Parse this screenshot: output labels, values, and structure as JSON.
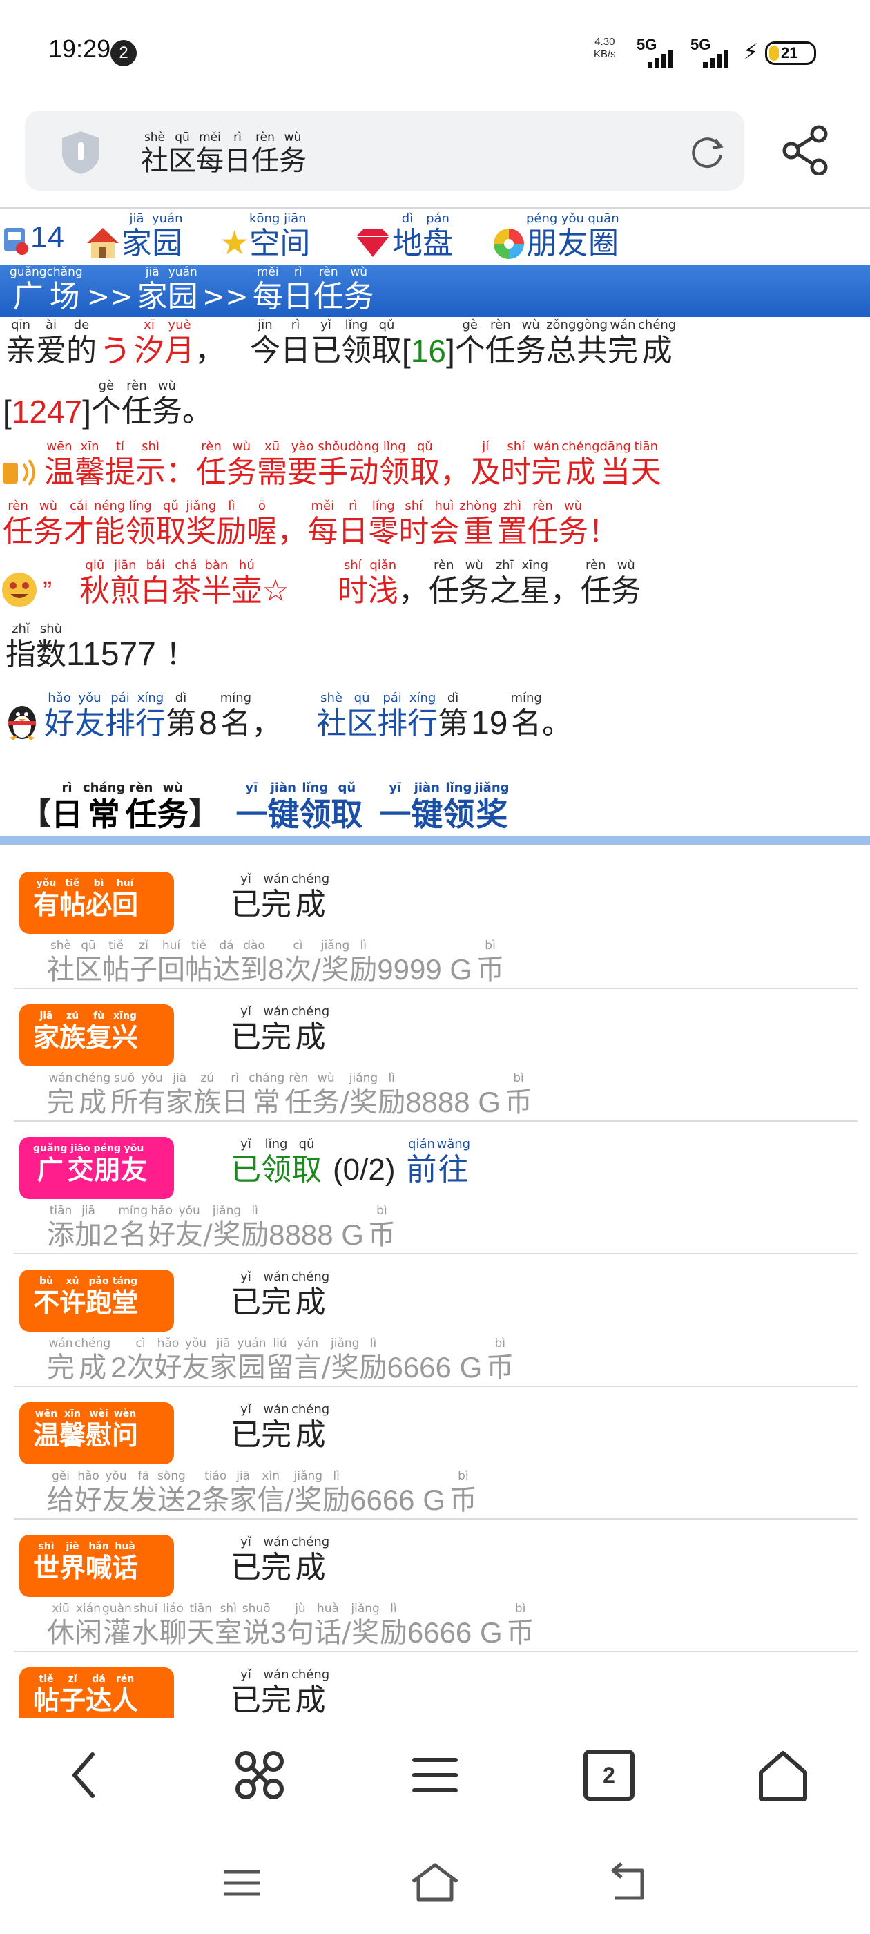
{
  "status_bar": {
    "time": "19:29",
    "notification_count": "2",
    "net_speed_value": "4.30",
    "net_speed_unit": "KB/s",
    "signal1": "5G",
    "signal2": "5G",
    "battery": "21"
  },
  "address_bar": {
    "title_chars": [
      {
        "hz": "社",
        "py": "shè"
      },
      {
        "hz": "区",
        "py": "qū"
      },
      {
        "hz": "每",
        "py": "měi"
      },
      {
        "hz": "日",
        "py": "rì"
      },
      {
        "hz": "任",
        "py": "rèn"
      },
      {
        "hz": "务",
        "py": "wù"
      }
    ]
  },
  "top_nav": {
    "mail_count": "14",
    "items": [
      {
        "icon": "house-icon",
        "chars": [
          {
            "hz": "家",
            "py": "jiā"
          },
          {
            "hz": "园",
            "py": "yuán"
          }
        ]
      },
      {
        "icon": "star-icon",
        "chars": [
          {
            "hz": "空",
            "py": "kōng"
          },
          {
            "hz": "间",
            "py": "jiān"
          }
        ]
      },
      {
        "icon": "gem-icon",
        "chars": [
          {
            "hz": "地",
            "py": "dì"
          },
          {
            "hz": "盘",
            "py": "pán"
          }
        ]
      },
      {
        "icon": "pinwheel-icon",
        "chars": [
          {
            "hz": "朋",
            "py": "péng"
          },
          {
            "hz": "友",
            "py": "yǒu"
          },
          {
            "hz": "圈",
            "py": "quān"
          }
        ]
      }
    ]
  },
  "breadcrumb": {
    "parts": [
      [
        {
          "hz": "广",
          "py": "guǎng"
        },
        {
          "hz": "场",
          "py": "chǎng"
        }
      ],
      [
        {
          "hz": "家",
          "py": "jiā"
        },
        {
          "hz": "园",
          "py": "yuán"
        }
      ],
      [
        {
          "hz": "每",
          "py": "měi"
        },
        {
          "hz": "日",
          "py": "rì"
        },
        {
          "hz": "任",
          "py": "rèn"
        },
        {
          "hz": "务",
          "py": "wù"
        }
      ]
    ],
    "separator": ">>"
  },
  "intro": {
    "prefix": [
      {
        "hz": "亲",
        "py": "qīn"
      },
      {
        "hz": "爱",
        "py": "ài"
      },
      {
        "hz": "的",
        "py": "de"
      }
    ],
    "username_mark": "う",
    "username": [
      {
        "hz": "汐",
        "py": "xī"
      },
      {
        "hz": "月",
        "py": "yuè"
      }
    ],
    "comma": "，",
    "today_text": [
      {
        "hz": "今",
        "py": "jīn"
      },
      {
        "hz": "日",
        "py": "rì"
      },
      {
        "hz": "已",
        "py": "yǐ"
      },
      {
        "hz": "领",
        "py": "lǐng"
      },
      {
        "hz": "取",
        "py": "qǔ"
      }
    ],
    "today_count": "16",
    "mid_text": [
      {
        "hz": "个",
        "py": "gè"
      },
      {
        "hz": "任",
        "py": "rèn"
      },
      {
        "hz": "务",
        "py": "wù"
      },
      {
        "hz": " ",
        "py": ""
      },
      {
        "hz": "总",
        "py": "zǒng"
      },
      {
        "hz": "共",
        "py": "gòng"
      },
      {
        "hz": "完",
        "py": "wán"
      },
      {
        "hz": "成",
        "py": "chéng"
      }
    ],
    "total_count": "1247",
    "end_text": [
      {
        "hz": "个",
        "py": "gè"
      },
      {
        "hz": "任",
        "py": "rèn"
      },
      {
        "hz": "务",
        "py": "wù"
      },
      {
        "hz": "。",
        "py": ""
      }
    ]
  },
  "tip": {
    "label": [
      {
        "hz": "温",
        "py": "wēn"
      },
      {
        "hz": "馨",
        "py": "xīn"
      },
      {
        "hz": "提",
        "py": "tí"
      },
      {
        "hz": "示",
        "py": "shì"
      },
      {
        "hz": "：",
        "py": ""
      }
    ],
    "line1": [
      {
        "hz": "任",
        "py": "rèn"
      },
      {
        "hz": "务",
        "py": "wù"
      },
      {
        "hz": "需",
        "py": "xū"
      },
      {
        "hz": "要",
        "py": "yào"
      },
      {
        "hz": "手",
        "py": "shǒu"
      },
      {
        "hz": "动",
        "py": "dòng"
      },
      {
        "hz": "领",
        "py": "lǐng"
      },
      {
        "hz": "取",
        "py": "qǔ"
      },
      {
        "hz": "，",
        "py": ""
      },
      {
        "hz": "及",
        "py": "jí"
      },
      {
        "hz": "时",
        "py": "shí"
      },
      {
        "hz": "完",
        "py": "wán"
      },
      {
        "hz": "成",
        "py": "chéng"
      },
      {
        "hz": "当",
        "py": "dāng"
      },
      {
        "hz": "天",
        "py": "tiān"
      }
    ],
    "line2": [
      {
        "hz": "任",
        "py": "rèn"
      },
      {
        "hz": "务",
        "py": "wù"
      },
      {
        "hz": "才",
        "py": "cái"
      },
      {
        "hz": "能",
        "py": "néng"
      },
      {
        "hz": "领",
        "py": "lǐng"
      },
      {
        "hz": "取",
        "py": "qǔ"
      },
      {
        "hz": "奖",
        "py": "jiǎng"
      },
      {
        "hz": "励",
        "py": "lì"
      },
      {
        "hz": "喔",
        "py": "ō"
      },
      {
        "hz": "，",
        "py": ""
      },
      {
        "hz": "每",
        "py": "měi"
      },
      {
        "hz": "日",
        "py": "rì"
      },
      {
        "hz": "零",
        "py": "líng"
      },
      {
        "hz": "时",
        "py": "shí"
      },
      {
        "hz": "会",
        "py": "huì"
      },
      {
        "hz": "重",
        "py": "zhòng"
      },
      {
        "hz": "置",
        "py": "zhì"
      },
      {
        "hz": "任",
        "py": "rèn"
      },
      {
        "hz": "务",
        "py": "wù"
      },
      {
        "hz": "！",
        "py": ""
      }
    ]
  },
  "star": {
    "quote_mark": "”",
    "name": [
      {
        "hz": "秋",
        "py": "qiū"
      },
      {
        "hz": "煎",
        "py": "jiān"
      },
      {
        "hz": "白",
        "py": "bái"
      },
      {
        "hz": "茶",
        "py": "chá"
      },
      {
        "hz": "半",
        "py": "bàn"
      },
      {
        "hz": "壶",
        "py": "hú"
      },
      {
        "hz": "☆",
        "py": ""
      }
    ],
    "rank_word": [
      {
        "hz": "时",
        "py": "shí"
      },
      {
        "hz": "浅",
        "py": "qiǎn"
      }
    ],
    "text": [
      {
        "hz": "，",
        "py": ""
      },
      {
        "hz": "任",
        "py": "rèn"
      },
      {
        "hz": "务",
        "py": "wù"
      },
      {
        "hz": "之",
        "py": "zhī"
      },
      {
        "hz": "星",
        "py": "xīng"
      },
      {
        "hz": "，",
        "py": ""
      },
      {
        "hz": "任",
        "py": "rèn"
      },
      {
        "hz": "务",
        "py": "wù"
      }
    ],
    "index_label": [
      {
        "hz": "指",
        "py": "zhǐ"
      },
      {
        "hz": "数",
        "py": "shù"
      }
    ],
    "index_value": "11577",
    "exclaim": "！"
  },
  "ranking": {
    "friend_label": [
      {
        "hz": "好",
        "py": "hǎo"
      },
      {
        "hz": "友",
        "py": "yǒu"
      },
      {
        "hz": "排",
        "py": "pái"
      },
      {
        "hz": "行",
        "py": "xíng"
      }
    ],
    "friend_rank": "8",
    "community_label": [
      {
        "hz": "社",
        "py": "shè"
      },
      {
        "hz": "区",
        "py": "qū"
      },
      {
        "hz": "排",
        "py": "pái"
      },
      {
        "hz": "行",
        "py": "xíng"
      }
    ],
    "community_rank": "19",
    "di": {
      "hz": "第",
      "py": "dì"
    },
    "ming": {
      "hz": "名",
      "py": "míng"
    },
    "comma": "，",
    "period": "。"
  },
  "daily": {
    "open_bracket": "【",
    "title": [
      {
        "hz": "日",
        "py": "rì"
      },
      {
        "hz": "常",
        "py": "cháng"
      },
      {
        "hz": "任",
        "py": "rèn"
      },
      {
        "hz": "务",
        "py": "wù"
      }
    ],
    "close_bracket": "】",
    "claim_all": [
      {
        "hz": "一",
        "py": "yī"
      },
      {
        "hz": "键",
        "py": "jiàn"
      },
      {
        "hz": "领",
        "py": "lǐng"
      },
      {
        "hz": "取",
        "py": "qǔ"
      }
    ],
    "claim_rewards": [
      {
        "hz": "一",
        "py": "yī"
      },
      {
        "hz": "键",
        "py": "jiàn"
      },
      {
        "hz": "领",
        "py": "lǐng"
      },
      {
        "hz": "奖",
        "py": "jiǎng"
      }
    ]
  },
  "tasks": [
    {
      "tag": [
        {
          "hz": "有",
          "py": "yǒu"
        },
        {
          "hz": "帖",
          "py": "tiě"
        },
        {
          "hz": "必",
          "py": "bì"
        },
        {
          "hz": "回",
          "py": "huí"
        }
      ],
      "tag_color": "#ff6a00",
      "status": [
        {
          "hz": "已",
          "py": "yǐ"
        },
        {
          "hz": "完",
          "py": "wán"
        },
        {
          "hz": "成",
          "py": "chéng"
        }
      ],
      "desc_a": [
        {
          "hz": "社",
          "py": "shè"
        },
        {
          "hz": "区",
          "py": "qū"
        },
        {
          "hz": "帖",
          "py": "tiě"
        },
        {
          "hz": "子",
          "py": "zǐ"
        },
        {
          "hz": "回",
          "py": "huí"
        },
        {
          "hz": "帖",
          "py": "tiě"
        },
        {
          "hz": "达",
          "py": "dá"
        },
        {
          "hz": "到",
          "py": "dào"
        }
      ],
      "desc_num": "8",
      "desc_b": [
        {
          "hz": "次",
          "py": "cì"
        },
        {
          "hz": "/",
          "py": ""
        },
        {
          "hz": "奖",
          "py": "jiǎng"
        },
        {
          "hz": "励",
          "py": "lì"
        }
      ],
      "reward": "9999 G",
      "currency": {
        "hz": "币",
        "py": "bì"
      }
    },
    {
      "tag": [
        {
          "hz": "家",
          "py": "jiā"
        },
        {
          "hz": "族",
          "py": "zú"
        },
        {
          "hz": "复",
          "py": "fù"
        },
        {
          "hz": "兴",
          "py": "xīng"
        }
      ],
      "tag_color": "#ff6a00",
      "status": [
        {
          "hz": "已",
          "py": "yǐ"
        },
        {
          "hz": "完",
          "py": "wán"
        },
        {
          "hz": "成",
          "py": "chéng"
        }
      ],
      "desc_a": [
        {
          "hz": "完",
          "py": "wán"
        },
        {
          "hz": "成",
          "py": "chéng"
        },
        {
          "hz": "所",
          "py": "suǒ"
        },
        {
          "hz": "有",
          "py": "yǒu"
        },
        {
          "hz": "家",
          "py": "jiā"
        },
        {
          "hz": "族",
          "py": "zú"
        },
        {
          "hz": "日",
          "py": "rì"
        },
        {
          "hz": "常",
          "py": "cháng"
        },
        {
          "hz": "任",
          "py": "rèn"
        },
        {
          "hz": "务",
          "py": "wù"
        }
      ],
      "desc_num": "",
      "desc_b": [
        {
          "hz": "/",
          "py": ""
        },
        {
          "hz": "奖",
          "py": "jiǎng"
        },
        {
          "hz": "励",
          "py": "lì"
        }
      ],
      "reward": "8888 G",
      "currency": {
        "hz": "币",
        "py": "bì"
      }
    },
    {
      "tag": [
        {
          "hz": "广",
          "py": "guǎng"
        },
        {
          "hz": "交",
          "py": "jiāo"
        },
        {
          "hz": "朋",
          "py": "péng"
        },
        {
          "hz": "友",
          "py": "yǒu"
        }
      ],
      "tag_color": "#ff1e8c",
      "status_green": [
        {
          "hz": "已",
          "py": "yǐ"
        },
        {
          "hz": "领",
          "py": "lǐng"
        },
        {
          "hz": "取",
          "py": "qǔ"
        }
      ],
      "progress": "(0/2)",
      "go_link": [
        {
          "hz": "前",
          "py": "qián"
        },
        {
          "hz": "往",
          "py": "wǎng"
        }
      ],
      "desc_a": [
        {
          "hz": "添",
          "py": "tiān"
        },
        {
          "hz": "加",
          "py": "jiā"
        }
      ],
      "desc_num": "2",
      "desc_b": [
        {
          "hz": "名",
          "py": "míng"
        },
        {
          "hz": "好",
          "py": "hǎo"
        },
        {
          "hz": "友",
          "py": "yǒu"
        },
        {
          "hz": "/",
          "py": ""
        },
        {
          "hz": "奖",
          "py": "jiǎng"
        },
        {
          "hz": "励",
          "py": "lì"
        }
      ],
      "reward": "8888 G",
      "currency": {
        "hz": "币",
        "py": "bì"
      }
    },
    {
      "tag": [
        {
          "hz": "不",
          "py": "bù"
        },
        {
          "hz": "许",
          "py": "xǔ"
        },
        {
          "hz": "跑",
          "py": "pǎo"
        },
        {
          "hz": "堂",
          "py": "táng"
        }
      ],
      "tag_color": "#ff6a00",
      "status": [
        {
          "hz": "已",
          "py": "yǐ"
        },
        {
          "hz": "完",
          "py": "wán"
        },
        {
          "hz": "成",
          "py": "chéng"
        }
      ],
      "desc_a": [
        {
          "hz": "完",
          "py": "wán"
        },
        {
          "hz": "成",
          "py": "chéng"
        }
      ],
      "desc_num": "2",
      "desc_b": [
        {
          "hz": "次",
          "py": "cì"
        },
        {
          "hz": "好",
          "py": "hǎo"
        },
        {
          "hz": "友",
          "py": "yǒu"
        },
        {
          "hz": "家",
          "py": "jiā"
        },
        {
          "hz": "园",
          "py": "yuán"
        },
        {
          "hz": "留",
          "py": "liú"
        },
        {
          "hz": "言",
          "py": "yán"
        },
        {
          "hz": "/",
          "py": ""
        },
        {
          "hz": "奖",
          "py": "jiǎng"
        },
        {
          "hz": "励",
          "py": "lì"
        }
      ],
      "reward": "6666 G",
      "currency": {
        "hz": "币",
        "py": "bì"
      }
    },
    {
      "tag": [
        {
          "hz": "温",
          "py": "wēn"
        },
        {
          "hz": "馨",
          "py": "xīn"
        },
        {
          "hz": "慰",
          "py": "wèi"
        },
        {
          "hz": "问",
          "py": "wèn"
        }
      ],
      "tag_color": "#ff6a00",
      "status": [
        {
          "hz": "已",
          "py": "yǐ"
        },
        {
          "hz": "完",
          "py": "wán"
        },
        {
          "hz": "成",
          "py": "chéng"
        }
      ],
      "desc_a": [
        {
          "hz": "给",
          "py": "gěi"
        },
        {
          "hz": "好",
          "py": "hǎo"
        },
        {
          "hz": "友",
          "py": "yǒu"
        },
        {
          "hz": "发",
          "py": "fā"
        },
        {
          "hz": "送",
          "py": "sòng"
        }
      ],
      "desc_num": "2",
      "desc_b": [
        {
          "hz": "条",
          "py": "tiáo"
        },
        {
          "hz": "家",
          "py": "jiā"
        },
        {
          "hz": "信",
          "py": "xìn"
        },
        {
          "hz": "/",
          "py": ""
        },
        {
          "hz": "奖",
          "py": "jiǎng"
        },
        {
          "hz": "励",
          "py": "lì"
        }
      ],
      "reward": "6666 G",
      "currency": {
        "hz": "币",
        "py": "bì"
      }
    },
    {
      "tag": [
        {
          "hz": "世",
          "py": "shì"
        },
        {
          "hz": "界",
          "py": "jiè"
        },
        {
          "hz": "喊",
          "py": "hǎn"
        },
        {
          "hz": "话",
          "py": "huà"
        }
      ],
      "tag_color": "#ff6a00",
      "status": [
        {
          "hz": "已",
          "py": "yǐ"
        },
        {
          "hz": "完",
          "py": "wán"
        },
        {
          "hz": "成",
          "py": "chéng"
        }
      ],
      "desc_a": [
        {
          "hz": "休",
          "py": "xiū"
        },
        {
          "hz": "闲",
          "py": "xián"
        },
        {
          "hz": "灌",
          "py": "guàn"
        },
        {
          "hz": "水",
          "py": "shuǐ"
        },
        {
          "hz": "聊",
          "py": "liáo"
        },
        {
          "hz": "天",
          "py": "tiān"
        },
        {
          "hz": "室",
          "py": "shì"
        },
        {
          "hz": "说",
          "py": "shuō"
        }
      ],
      "desc_num": "3",
      "desc_b": [
        {
          "hz": "句",
          "py": "jù"
        },
        {
          "hz": "话",
          "py": "huà"
        },
        {
          "hz": "/",
          "py": ""
        },
        {
          "hz": "奖",
          "py": "jiǎng"
        },
        {
          "hz": "励",
          "py": "lì"
        }
      ],
      "reward": "6666 G",
      "currency": {
        "hz": "币",
        "py": "bì"
      }
    },
    {
      "tag": [
        {
          "hz": "帖",
          "py": "tiě"
        },
        {
          "hz": "子",
          "py": "zǐ"
        },
        {
          "hz": "达",
          "py": "dá"
        },
        {
          "hz": "人",
          "py": "rén"
        }
      ],
      "tag_color": "#ff6a00",
      "status": [
        {
          "hz": "已",
          "py": "yǐ"
        },
        {
          "hz": "完",
          "py": "wán"
        },
        {
          "hz": "成",
          "py": "chéng"
        }
      ]
    }
  ],
  "bottom_bar": {
    "tab_count": "2",
    "icons": [
      "back-icon",
      "command-icon",
      "menu-icon",
      "tabs-icon",
      "home-icon"
    ]
  },
  "system_nav": {
    "icons": [
      "recents-icon",
      "home-icon",
      "back-icon"
    ]
  }
}
